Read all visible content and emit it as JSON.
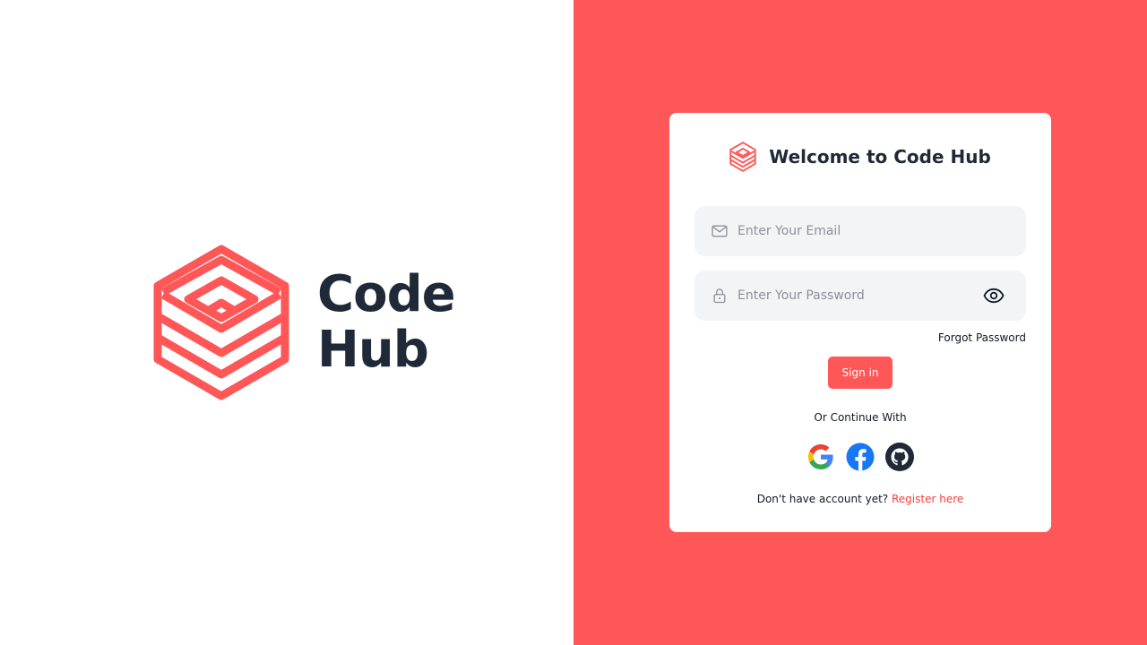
{
  "brand": {
    "name_line1": "Code",
    "name_line2": "Hub",
    "logo_icon": "hexagon-cube-logo",
    "accent_color": "#ff5757"
  },
  "login": {
    "title": "Welcome to Code Hub",
    "email_placeholder": "Enter Your Email",
    "email_value": "",
    "password_placeholder": "Enter Your Password",
    "password_value": "",
    "forgot_label": "Forgot Password",
    "signin_label": "Sign in",
    "divider_text": "Or Continue With",
    "register_prompt": "Don't have account yet?",
    "register_link": "Register here"
  },
  "icons": {
    "email": "mail-icon",
    "password": "lock-icon",
    "toggle": "eye-icon",
    "google": "google-icon",
    "facebook": "facebook-icon",
    "github": "github-icon"
  }
}
